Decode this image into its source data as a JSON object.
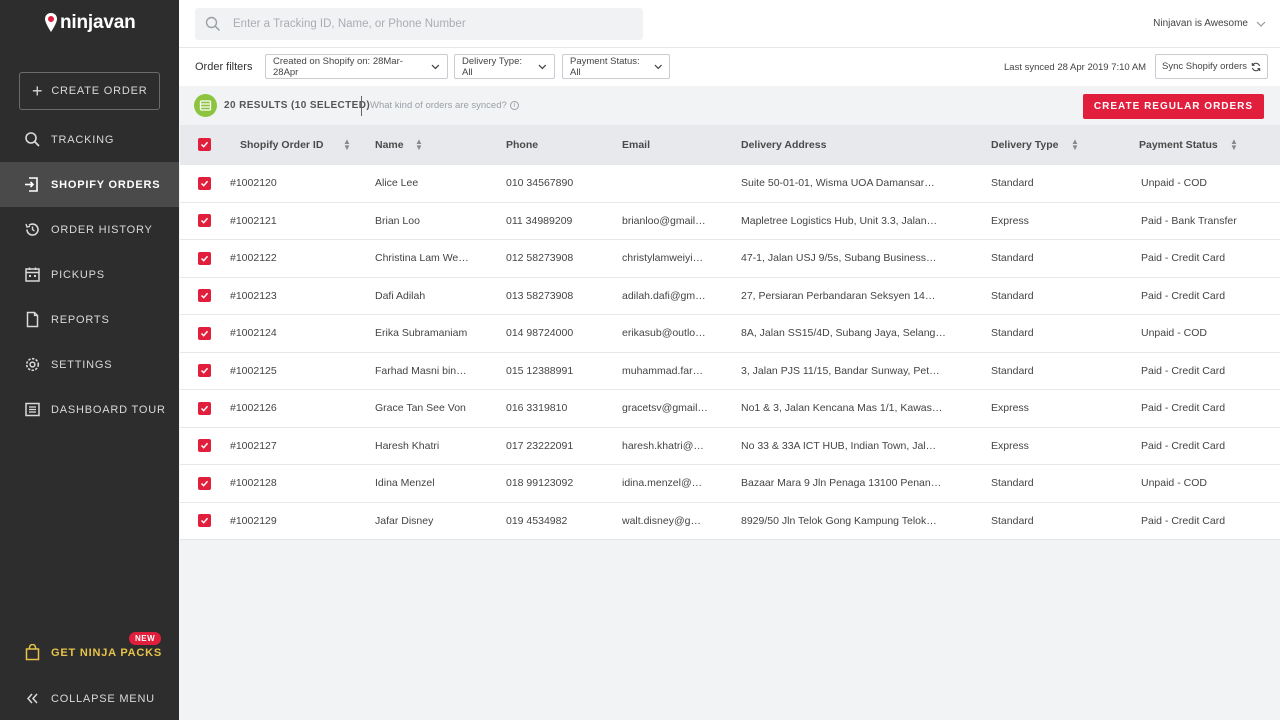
{
  "brand": {
    "logo_text": "ninjavan"
  },
  "sidebar": {
    "create_order": "CREATE ORDER",
    "items": [
      {
        "label": "TRACKING",
        "icon": "search-icon"
      },
      {
        "label": "SHOPIFY ORDERS",
        "icon": "import-icon",
        "active": true
      },
      {
        "label": "ORDER HISTORY",
        "icon": "history-icon"
      },
      {
        "label": "PICKUPS",
        "icon": "calendar-icon"
      },
      {
        "label": "REPORTS",
        "icon": "document-icon"
      },
      {
        "label": "SETTINGS",
        "icon": "gear-icon"
      },
      {
        "label": "DASHBOARD TOUR",
        "icon": "list-icon"
      }
    ],
    "ninja_packs": "GET NINJA PACKS",
    "ninja_packs_badge": "NEW",
    "collapse": "COLLAPSE MENU"
  },
  "topbar": {
    "search_placeholder": "Enter a Tracking ID, Name, or Phone Number",
    "user": "Ninjavan  is Awesome"
  },
  "filters": {
    "label": "Order filters",
    "created": "Created on Shopify on: 28Mar-28Apr",
    "delivery_type": "Delivery Type: All",
    "payment_status": "Payment Status: All",
    "last_synced": "Last synced 28 Apr 2019 7:10 AM",
    "sync_button": "Sync Shopify orders"
  },
  "results": {
    "count": "20 RESULTS (10 SELECTED)",
    "help": "What kind of orders are synced?",
    "cta": "CREATE REGULAR ORDERS"
  },
  "table": {
    "headers": [
      "Shopify Order ID",
      "Name",
      "Phone",
      "Email",
      "Delivery Address",
      "Delivery Type",
      "Payment Status"
    ],
    "rows": [
      {
        "id": "#1002120",
        "name": "Alice Lee",
        "phone": "010 34567890",
        "email": "",
        "address": "Suite 50-01-01, Wisma UOA Damansar…",
        "type": "Standard",
        "payment": "Unpaid - COD"
      },
      {
        "id": "#1002121",
        "name": "Brian Loo",
        "phone": "011 34989209",
        "email": "brianloo@gmail…",
        "address": "Mapletree Logistics Hub, Unit 3.3, Jalan…",
        "type": "Express",
        "payment": "Paid - Bank Transfer"
      },
      {
        "id": "#1002122",
        "name": "Christina Lam We…",
        "phone": "012 58273908",
        "email": "christylamweiyi…",
        "address": "47-1, Jalan USJ 9/5s, Subang Business…",
        "type": "Standard",
        "payment": "Paid - Credit Card"
      },
      {
        "id": "#1002123",
        "name": "Dafi Adilah",
        "phone": "013 58273908",
        "email": "adilah.dafi@gm…",
        "address": "27, Persiaran Perbandaran Seksyen 14…",
        "type": "Standard",
        "payment": "Paid - Credit Card"
      },
      {
        "id": "#1002124",
        "name": "Erika Subramaniam",
        "phone": "014 98724000",
        "email": "erikasub@outlo…",
        "address": "8A, Jalan SS15/4D, Subang Jaya, Selang…",
        "type": "Standard",
        "payment": "Unpaid - COD"
      },
      {
        "id": "#1002125",
        "name": "Farhad Masni bin…",
        "phone": "015 12388991",
        "email": "muhammad.far…",
        "address": "3, Jalan PJS 11/15, Bandar Sunway, Pet…",
        "type": "Standard",
        "payment": "Paid - Credit Card"
      },
      {
        "id": "#1002126",
        "name": "Grace Tan See Von",
        "phone": "016 3319810",
        "email": "gracetsv@gmail…",
        "address": "No1 & 3, Jalan Kencana Mas 1/1, Kawas…",
        "type": "Express",
        "payment": "Paid - Credit Card"
      },
      {
        "id": "#1002127",
        "name": "Haresh Khatri",
        "phone": "017 23222091",
        "email": "haresh.khatri@…",
        "address": "No 33 & 33A ICT HUB, Indian Town, Jal…",
        "type": "Express",
        "payment": "Paid - Credit Card"
      },
      {
        "id": "#1002128",
        "name": "Idina Menzel",
        "phone": "018 99123092",
        "email": "idina.menzel@…",
        "address": "Bazaar Mara 9 Jln Penaga 13100 Penan…",
        "type": "Standard",
        "payment": "Unpaid - COD"
      },
      {
        "id": "#1002129",
        "name": "Jafar Disney",
        "phone": "019 4534982",
        "email": "walt.disney@g…",
        "address": "8929/50 Jln Telok Gong Kampung Telok…",
        "type": "Standard",
        "payment": "Paid - Credit Card"
      }
    ]
  },
  "colors": {
    "accent": "#e21e3d",
    "sidebar": "#2d2d2d",
    "active_nav": "#4a4a4a",
    "success": "#8cc43f",
    "gold": "#e7c349"
  }
}
